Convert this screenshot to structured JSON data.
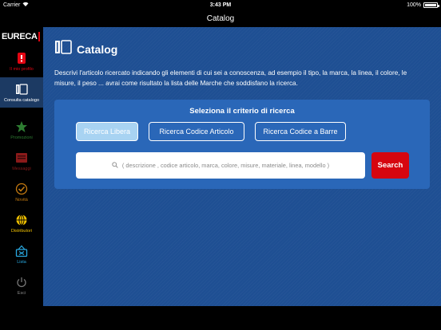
{
  "status_bar": {
    "carrier": "Carrier",
    "time": "3:43 PM",
    "battery": "100%",
    "battery_level": 1.0
  },
  "nav_bar": {
    "title": "Catalog"
  },
  "sidebar": {
    "logo_text": "EURECA",
    "items": [
      {
        "label": "Il mio profilo",
        "icon": "profile-icon",
        "color": "#e30613",
        "active": false
      },
      {
        "label": "Consulta catalogo",
        "icon": "catalog-book-icon",
        "color": "#ffffff",
        "active": true
      },
      {
        "label": "Promozioni",
        "icon": "star-icon",
        "color": "#2e7d32",
        "active": false
      },
      {
        "label": "Messaggi",
        "icon": "message-icon",
        "color": "#8b1a1a",
        "active": false
      },
      {
        "label": "Novità",
        "icon": "checkmark-icon",
        "color": "#c47a10",
        "active": false
      },
      {
        "label": "Distributori",
        "icon": "globe-icon",
        "color": "#f2c200",
        "active": false
      },
      {
        "label": "Lista",
        "icon": "basket-icon",
        "color": "#29a8e0",
        "active": false
      },
      {
        "label": "Esci",
        "icon": "power-icon",
        "color": "#777777",
        "active": false
      }
    ]
  },
  "main": {
    "title": "Catalog",
    "description": "Descrivi l'articolo ricercato indicando gli elementi di cui sei a conoscenza, ad esempio il tipo, la marca, la linea, il colore, le misure, il peso ... avrai come risultato la lista delle Marche che soddisfano la ricerca.",
    "panel": {
      "title": "Seleziona il criterio di ricerca",
      "criteria": [
        {
          "label": "Ricerca Libera",
          "selected": true
        },
        {
          "label": "Ricerca Codice Articolo",
          "selected": false
        },
        {
          "label": "Ricerca Codice a Barre",
          "selected": false
        }
      ],
      "search_placeholder": "( descrizione , codice articolo, marca, colore, misure, materiale, linea, modello )",
      "search_button": "Search"
    }
  },
  "colors": {
    "accent_blue": "#1e4f93",
    "panel_blue": "#2a67b8",
    "selected_criterion": "#a8d3f2",
    "search_red": "#d6060f",
    "brand_red": "#e30613"
  }
}
